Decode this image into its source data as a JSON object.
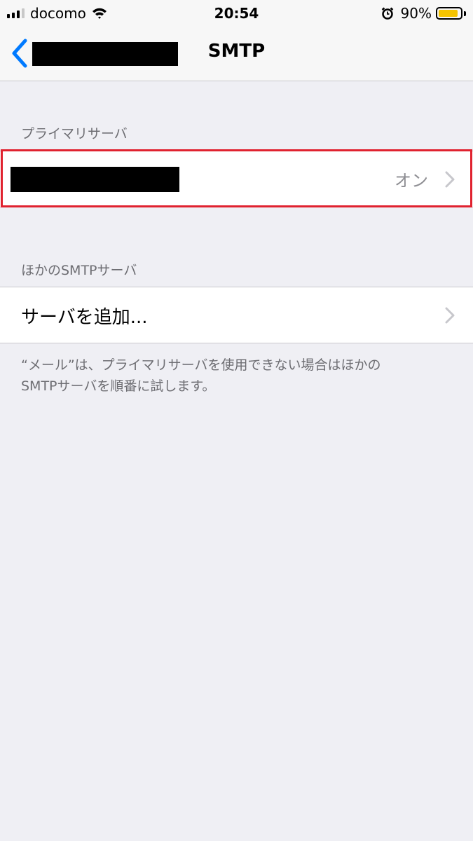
{
  "status_bar": {
    "carrier": "docomo",
    "time": "20:54",
    "battery_percent": "90%",
    "battery_level": 0.9,
    "icons": [
      "signal-icon",
      "wifi-icon",
      "alarm-icon",
      "battery-icon"
    ]
  },
  "nav": {
    "title": "SMTP",
    "back_icon": "chevron-left-icon",
    "back_label_redacted": true
  },
  "primary_section": {
    "header": "プライマリサーバ",
    "server": {
      "name_redacted": true,
      "status": "オン",
      "highlighted": true
    }
  },
  "other_section": {
    "header": "ほかのSMTPサーバ",
    "add_label": "サーバを追加..."
  },
  "footer": {
    "line1": "“メール”は、プライマリサーバを使用できない場合はほかの",
    "line2": "SMTPサーバを順番に試します。"
  },
  "colors": {
    "accent": "#007aff",
    "highlight_border": "#e0222f",
    "background": "#efeff4",
    "battery_fill": "#f5c400"
  }
}
